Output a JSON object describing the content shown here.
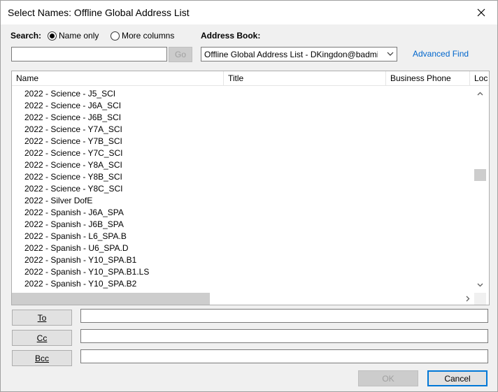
{
  "window": {
    "title": "Select Names: Offline Global Address List"
  },
  "search": {
    "label": "Search:",
    "option_name_only": "Name only",
    "option_more_columns": "More columns",
    "value": "",
    "go_label": "Go"
  },
  "address_book": {
    "label": "Address Book:",
    "selected": "Offline Global Address List - DKingdon@badminton",
    "advanced_find": "Advanced Find"
  },
  "columns": [
    "Name",
    "Title",
    "Business Phone",
    "Loc"
  ],
  "rows": [
    "2022 - Science - J5_SCI",
    "2022 - Science - J6A_SCI",
    "2022 - Science - J6B_SCI",
    "2022 - Science - Y7A_SCI",
    "2022 - Science - Y7B_SCI",
    "2022 - Science - Y7C_SCI",
    "2022 - Science - Y8A_SCI",
    "2022 - Science - Y8B_SCI",
    "2022 - Science - Y8C_SCI",
    "2022 - Silver DofE",
    "2022 - Spanish - J6A_SPA",
    "2022 - Spanish - J6B_SPA",
    "2022 - Spanish - L6_SPA.B",
    "2022 - Spanish - U6_SPA.D",
    "2022 - Spanish - Y10_SPA.B1",
    "2022 - Spanish - Y10_SPA.B1.LS",
    "2022 - Spanish - Y10_SPA.B2"
  ],
  "recipients": {
    "to_label": "To",
    "cc_label": "Cc",
    "bcc_label": "Bcc",
    "to_value": "",
    "cc_value": "",
    "bcc_value": ""
  },
  "footer": {
    "ok_label": "OK",
    "cancel_label": "Cancel"
  },
  "colors": {
    "accent": "#0078d7",
    "link": "#0066cc",
    "scrollbar_thumb": "#cdcdcd"
  }
}
